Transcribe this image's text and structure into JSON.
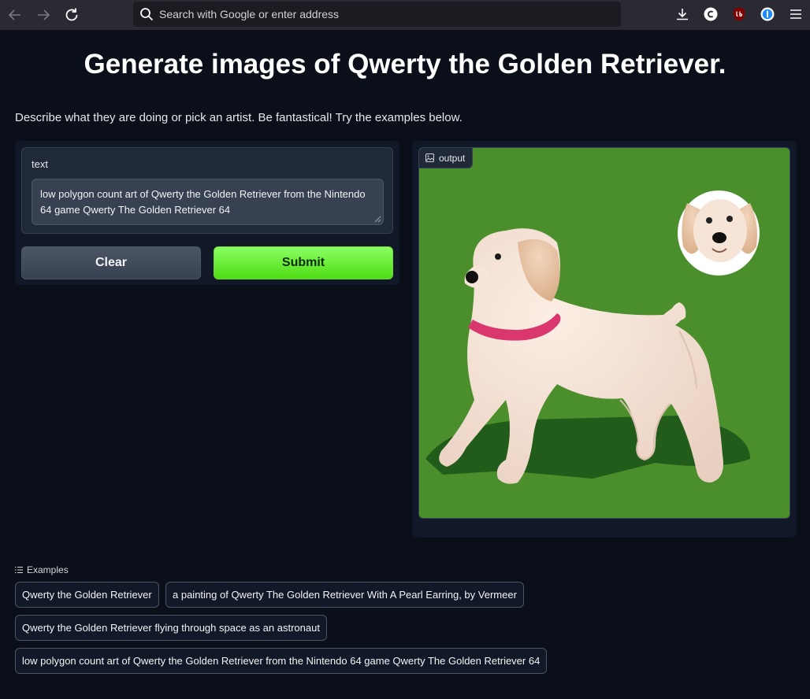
{
  "browser": {
    "address_placeholder": "Search with Google or enter address",
    "icons": [
      "back-icon",
      "forward-icon",
      "reload-icon",
      "search-icon",
      "download-icon",
      "extension-c-icon",
      "ublock-icon",
      "password-manager-icon",
      "menu-icon"
    ]
  },
  "page": {
    "title": "Generate images of Qwerty the Golden Retriever.",
    "description": "Describe what they are doing or pick an artist. Be fantastical! Try the examples below."
  },
  "input": {
    "label": "text",
    "value": "low polygon count art of Qwerty the Golden Retriever from the Nintendo 64 game Qwerty The Golden Retriever 64"
  },
  "buttons": {
    "clear": "Clear",
    "submit": "Submit"
  },
  "output": {
    "label": "output"
  },
  "examples": {
    "header": "Examples",
    "items": [
      "Qwerty the Golden Retriever",
      "a painting of Qwerty The Golden Retriever With A Pearl Earring, by Vermeer",
      "Qwerty the Golden Retriever flying through space as an astronaut",
      "low polygon count art of Qwerty the Golden Retriever from the Nintendo 64 game Qwerty The Golden Retriever 64"
    ]
  },
  "colors": {
    "background": "#0b0f19",
    "panel": "#111827",
    "submit_green": "#5ee51f",
    "image_green": "#4a8f2c"
  }
}
